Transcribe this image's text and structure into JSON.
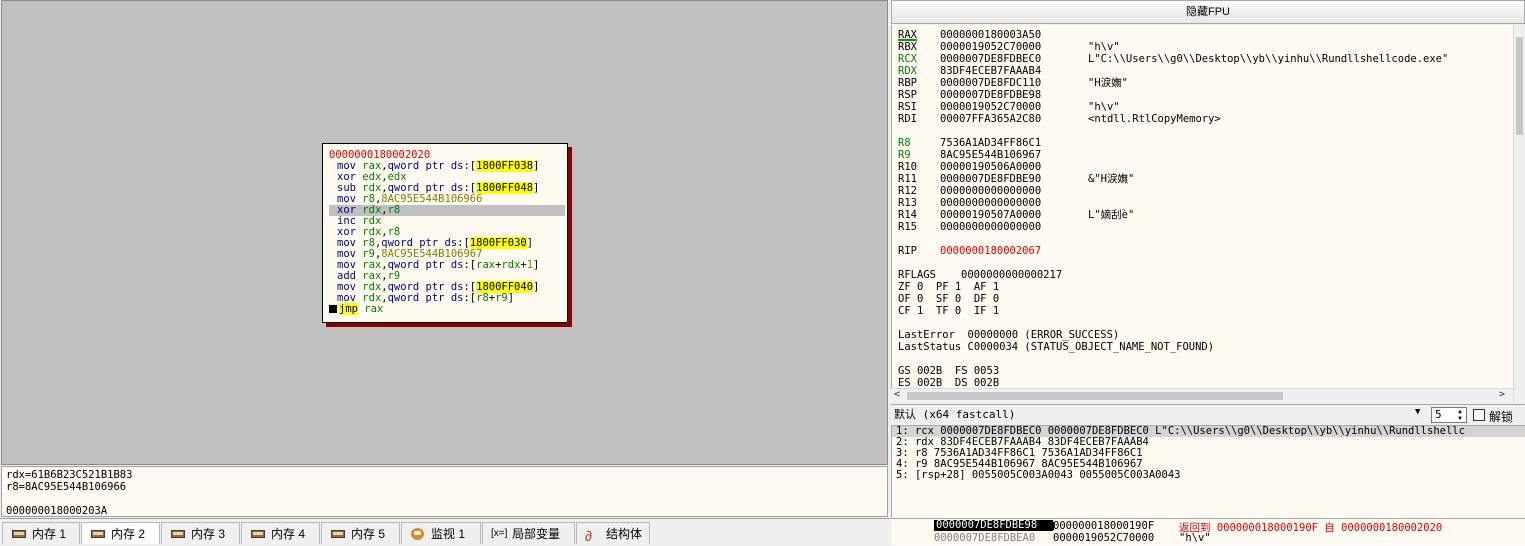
{
  "graph": {
    "block_address": "0000000180002020",
    "lines": [
      {
        "parts": [
          {
            "t": "mov ",
            "c": "kw"
          },
          {
            "t": "rax",
            "c": "reg"
          },
          {
            "t": ",",
            "c": ""
          },
          {
            "t": "qword ptr ",
            "c": "kw"
          },
          {
            "t": "ds",
            "c": "kw"
          },
          {
            "t": ":[",
            "c": ""
          },
          {
            "t": "1800FF038",
            "c": "hl"
          },
          {
            "t": "]",
            "c": ""
          }
        ]
      },
      {
        "parts": [
          {
            "t": "xor ",
            "c": "kw"
          },
          {
            "t": "edx",
            "c": "reg"
          },
          {
            "t": ",",
            "c": ""
          },
          {
            "t": "edx",
            "c": "reg"
          }
        ]
      },
      {
        "parts": [
          {
            "t": "sub ",
            "c": "kw"
          },
          {
            "t": "rdx",
            "c": "reg"
          },
          {
            "t": ",",
            "c": ""
          },
          {
            "t": "qword ptr ",
            "c": "kw"
          },
          {
            "t": "ds",
            "c": "kw"
          },
          {
            "t": ":[",
            "c": ""
          },
          {
            "t": "1800FF048",
            "c": "hl"
          },
          {
            "t": "]",
            "c": ""
          }
        ]
      },
      {
        "parts": [
          {
            "t": "mov ",
            "c": "kw"
          },
          {
            "t": "r8",
            "c": "reg"
          },
          {
            "t": ",",
            "c": ""
          },
          {
            "t": "8AC95E544B106966",
            "c": "imm"
          }
        ]
      },
      {
        "sel": true,
        "parts": [
          {
            "t": "xor ",
            "c": "kw"
          },
          {
            "t": "rdx",
            "c": "reg"
          },
          {
            "t": ",",
            "c": ""
          },
          {
            "t": "r8",
            "c": "reg"
          }
        ]
      },
      {
        "parts": [
          {
            "t": "inc ",
            "c": "kw"
          },
          {
            "t": "rdx",
            "c": "reg"
          }
        ]
      },
      {
        "parts": [
          {
            "t": "xor ",
            "c": "kw"
          },
          {
            "t": "rdx",
            "c": "reg"
          },
          {
            "t": ",",
            "c": ""
          },
          {
            "t": "r8",
            "c": "reg"
          }
        ]
      },
      {
        "parts": [
          {
            "t": "mov ",
            "c": "kw"
          },
          {
            "t": "r8",
            "c": "reg"
          },
          {
            "t": ",",
            "c": ""
          },
          {
            "t": "qword ptr ",
            "c": "kw"
          },
          {
            "t": "ds",
            "c": "kw"
          },
          {
            "t": ":[",
            "c": ""
          },
          {
            "t": "1800FF030",
            "c": "hl"
          },
          {
            "t": "]",
            "c": ""
          }
        ]
      },
      {
        "parts": [
          {
            "t": "mov ",
            "c": "kw"
          },
          {
            "t": "r9",
            "c": "reg"
          },
          {
            "t": ",",
            "c": ""
          },
          {
            "t": "8AC95E544B106967",
            "c": "imm"
          }
        ]
      },
      {
        "parts": [
          {
            "t": "mov ",
            "c": "kw"
          },
          {
            "t": "rax",
            "c": "reg"
          },
          {
            "t": ",",
            "c": ""
          },
          {
            "t": "qword ptr ",
            "c": "kw"
          },
          {
            "t": "ds",
            "c": "kw"
          },
          {
            "t": ":[",
            "c": ""
          },
          {
            "t": "rax",
            "c": "reg"
          },
          {
            "t": "+",
            "c": ""
          },
          {
            "t": "rdx",
            "c": "reg"
          },
          {
            "t": "+",
            "c": ""
          },
          {
            "t": "1",
            "c": "imm"
          },
          {
            "t": "]",
            "c": ""
          }
        ]
      },
      {
        "parts": [
          {
            "t": "add ",
            "c": "kw"
          },
          {
            "t": "rax",
            "c": "reg"
          },
          {
            "t": ",",
            "c": ""
          },
          {
            "t": "r9",
            "c": "reg"
          }
        ]
      },
      {
        "parts": [
          {
            "t": "mov ",
            "c": "kw"
          },
          {
            "t": "rdx",
            "c": "reg"
          },
          {
            "t": ",",
            "c": ""
          },
          {
            "t": "qword ptr ",
            "c": "kw"
          },
          {
            "t": "ds",
            "c": "kw"
          },
          {
            "t": ":[",
            "c": ""
          },
          {
            "t": "1800FF040",
            "c": "hl"
          },
          {
            "t": "]",
            "c": ""
          }
        ]
      },
      {
        "parts": [
          {
            "t": "mov ",
            "c": "kw"
          },
          {
            "t": "rdx",
            "c": "reg"
          },
          {
            "t": ",",
            "c": ""
          },
          {
            "t": "qword ptr ",
            "c": "kw"
          },
          {
            "t": "ds",
            "c": "kw"
          },
          {
            "t": ":[",
            "c": ""
          },
          {
            "t": "r8",
            "c": "reg"
          },
          {
            "t": "+",
            "c": ""
          },
          {
            "t": "r9",
            "c": "reg"
          },
          {
            "t": "]",
            "c": ""
          }
        ]
      },
      {
        "marker": true,
        "parts": [
          {
            "t": "jmp",
            "c": "jmp"
          },
          {
            "t": " ",
            "c": ""
          },
          {
            "t": "rax",
            "c": "reg"
          }
        ]
      }
    ]
  },
  "info": {
    "line1": "rdx=61B6B23C521B1B83",
    "line2": "r8=8AC95E544B106966",
    "line3": "",
    "line4": "000000018000203A"
  },
  "tabs": [
    {
      "label": "内存 1",
      "icon": "memory-icon"
    },
    {
      "label": "内存 2",
      "icon": "memory-icon",
      "active": true
    },
    {
      "label": "内存 3",
      "icon": "memory-icon"
    },
    {
      "label": "内存 4",
      "icon": "memory-icon"
    },
    {
      "label": "内存 5",
      "icon": "memory-icon"
    },
    {
      "label": "监视 1",
      "icon": "watch-icon"
    },
    {
      "label": "局部变量",
      "icon": "locals-icon",
      "glyph": "[x=]"
    },
    {
      "label": "结构体",
      "icon": "struct-icon"
    }
  ],
  "fpu_header": "隐藏FPU",
  "registers": [
    {
      "name": "RAX",
      "value": "0000000180003A50",
      "comment": "",
      "style": "u"
    },
    {
      "name": "RBX",
      "value": "0000019052C70000",
      "comment": "\"h\\v\""
    },
    {
      "name": "RCX",
      "value": "0000007DE8FDBEC0",
      "comment": "L\"C:\\\\Users\\\\g0\\\\Desktop\\\\yb\\\\yinhu\\\\Rundllshellcode.exe\"",
      "style": "chg"
    },
    {
      "name": "RDX",
      "value": "83DF4ECEB7FAAAB4",
      "comment": "",
      "style": "chg"
    },
    {
      "name": "RBP",
      "value": "0000007DE8FDC110",
      "comment": "\"H淚嫵\""
    },
    {
      "name": "RSP",
      "value": "0000007DE8FDBE98",
      "comment": ""
    },
    {
      "name": "RSI",
      "value": "0000019052C70000",
      "comment": "\"h\\v\""
    },
    {
      "name": "RDI",
      "value": "00007FFA365A2C80",
      "comment": "<ntdll.RtlCopyMemory>"
    },
    {
      "name": "",
      "value": "",
      "comment": ""
    },
    {
      "name": "R8",
      "value": "7536A1AD34FF86C1",
      "comment": "",
      "style": "chg"
    },
    {
      "name": "R9",
      "value": "8AC95E544B106967",
      "comment": "",
      "style": "chg"
    },
    {
      "name": "R10",
      "value": "00000190506A0000",
      "comment": ""
    },
    {
      "name": "R11",
      "value": "0000007DE8FDBE90",
      "comment": "&\"H淚嫵\""
    },
    {
      "name": "R12",
      "value": "0000000000000000",
      "comment": ""
    },
    {
      "name": "R13",
      "value": "0000000000000000",
      "comment": ""
    },
    {
      "name": "R14",
      "value": "00000190507A0000",
      "comment": "L\"嫡刮è\""
    },
    {
      "name": "R15",
      "value": "0000000000000000",
      "comment": ""
    },
    {
      "name": "",
      "value": "",
      "comment": ""
    },
    {
      "name": "RIP",
      "value": "0000000180002067",
      "comment": "",
      "style": "rip"
    },
    {
      "name": "",
      "value": "",
      "comment": ""
    },
    {
      "name": "RFLAGS",
      "value": "0000000000000217",
      "comment": "",
      "style": "flags"
    },
    {
      "raw": "ZF 0  PF 1  AF 1"
    },
    {
      "raw": "OF 0  SF 0  DF 0"
    },
    {
      "raw": "CF 1  TF 0  IF 1"
    },
    {
      "name": "",
      "value": "",
      "comment": ""
    },
    {
      "raw": "LastError  00000000 (ERROR_SUCCESS)"
    },
    {
      "raw": "LastStatus C0000034 (STATUS_OBJECT_NAME_NOT_FOUND)"
    },
    {
      "name": "",
      "value": "",
      "comment": ""
    },
    {
      "raw": "GS 002B  FS 0053"
    },
    {
      "raw": "ES 002B  DS 002B"
    }
  ],
  "callconv": {
    "label": "默认 (x64 fastcall)",
    "arg_count": "5",
    "unlock_label": "解锁"
  },
  "args": [
    "1: rcx 0000007DE8FDBEC0 0000007DE8FDBEC0 L\"C:\\\\Users\\\\g0\\\\Desktop\\\\yb\\\\yinhu\\\\Rundllshellc",
    "2: rdx 83DF4ECEB7FAAAB4 83DF4ECEB7FAAAB4",
    "3: r8 7536A1AD34FF86C1 7536A1AD34FF86C1",
    "4: r9 8AC95E544B106967 8AC95E544B106967",
    "5: [rsp+28] 0055005C003A0043 0055005C003A0043"
  ],
  "stack": {
    "addr1": "0000007DE8FDBE98",
    "val1": "000000018000190F",
    "cmt1": "返回到 000000018000190F 自 0000000180002020",
    "addr2": "0000007DE8FDBEA0",
    "val2": "0000019052C70000",
    "cmt2": "\"h\\v\""
  },
  "colors": {
    "changed_register": "#008000",
    "rip": "#e00000",
    "highlight": "#ffff00",
    "block_shadow": "#8b0000"
  }
}
